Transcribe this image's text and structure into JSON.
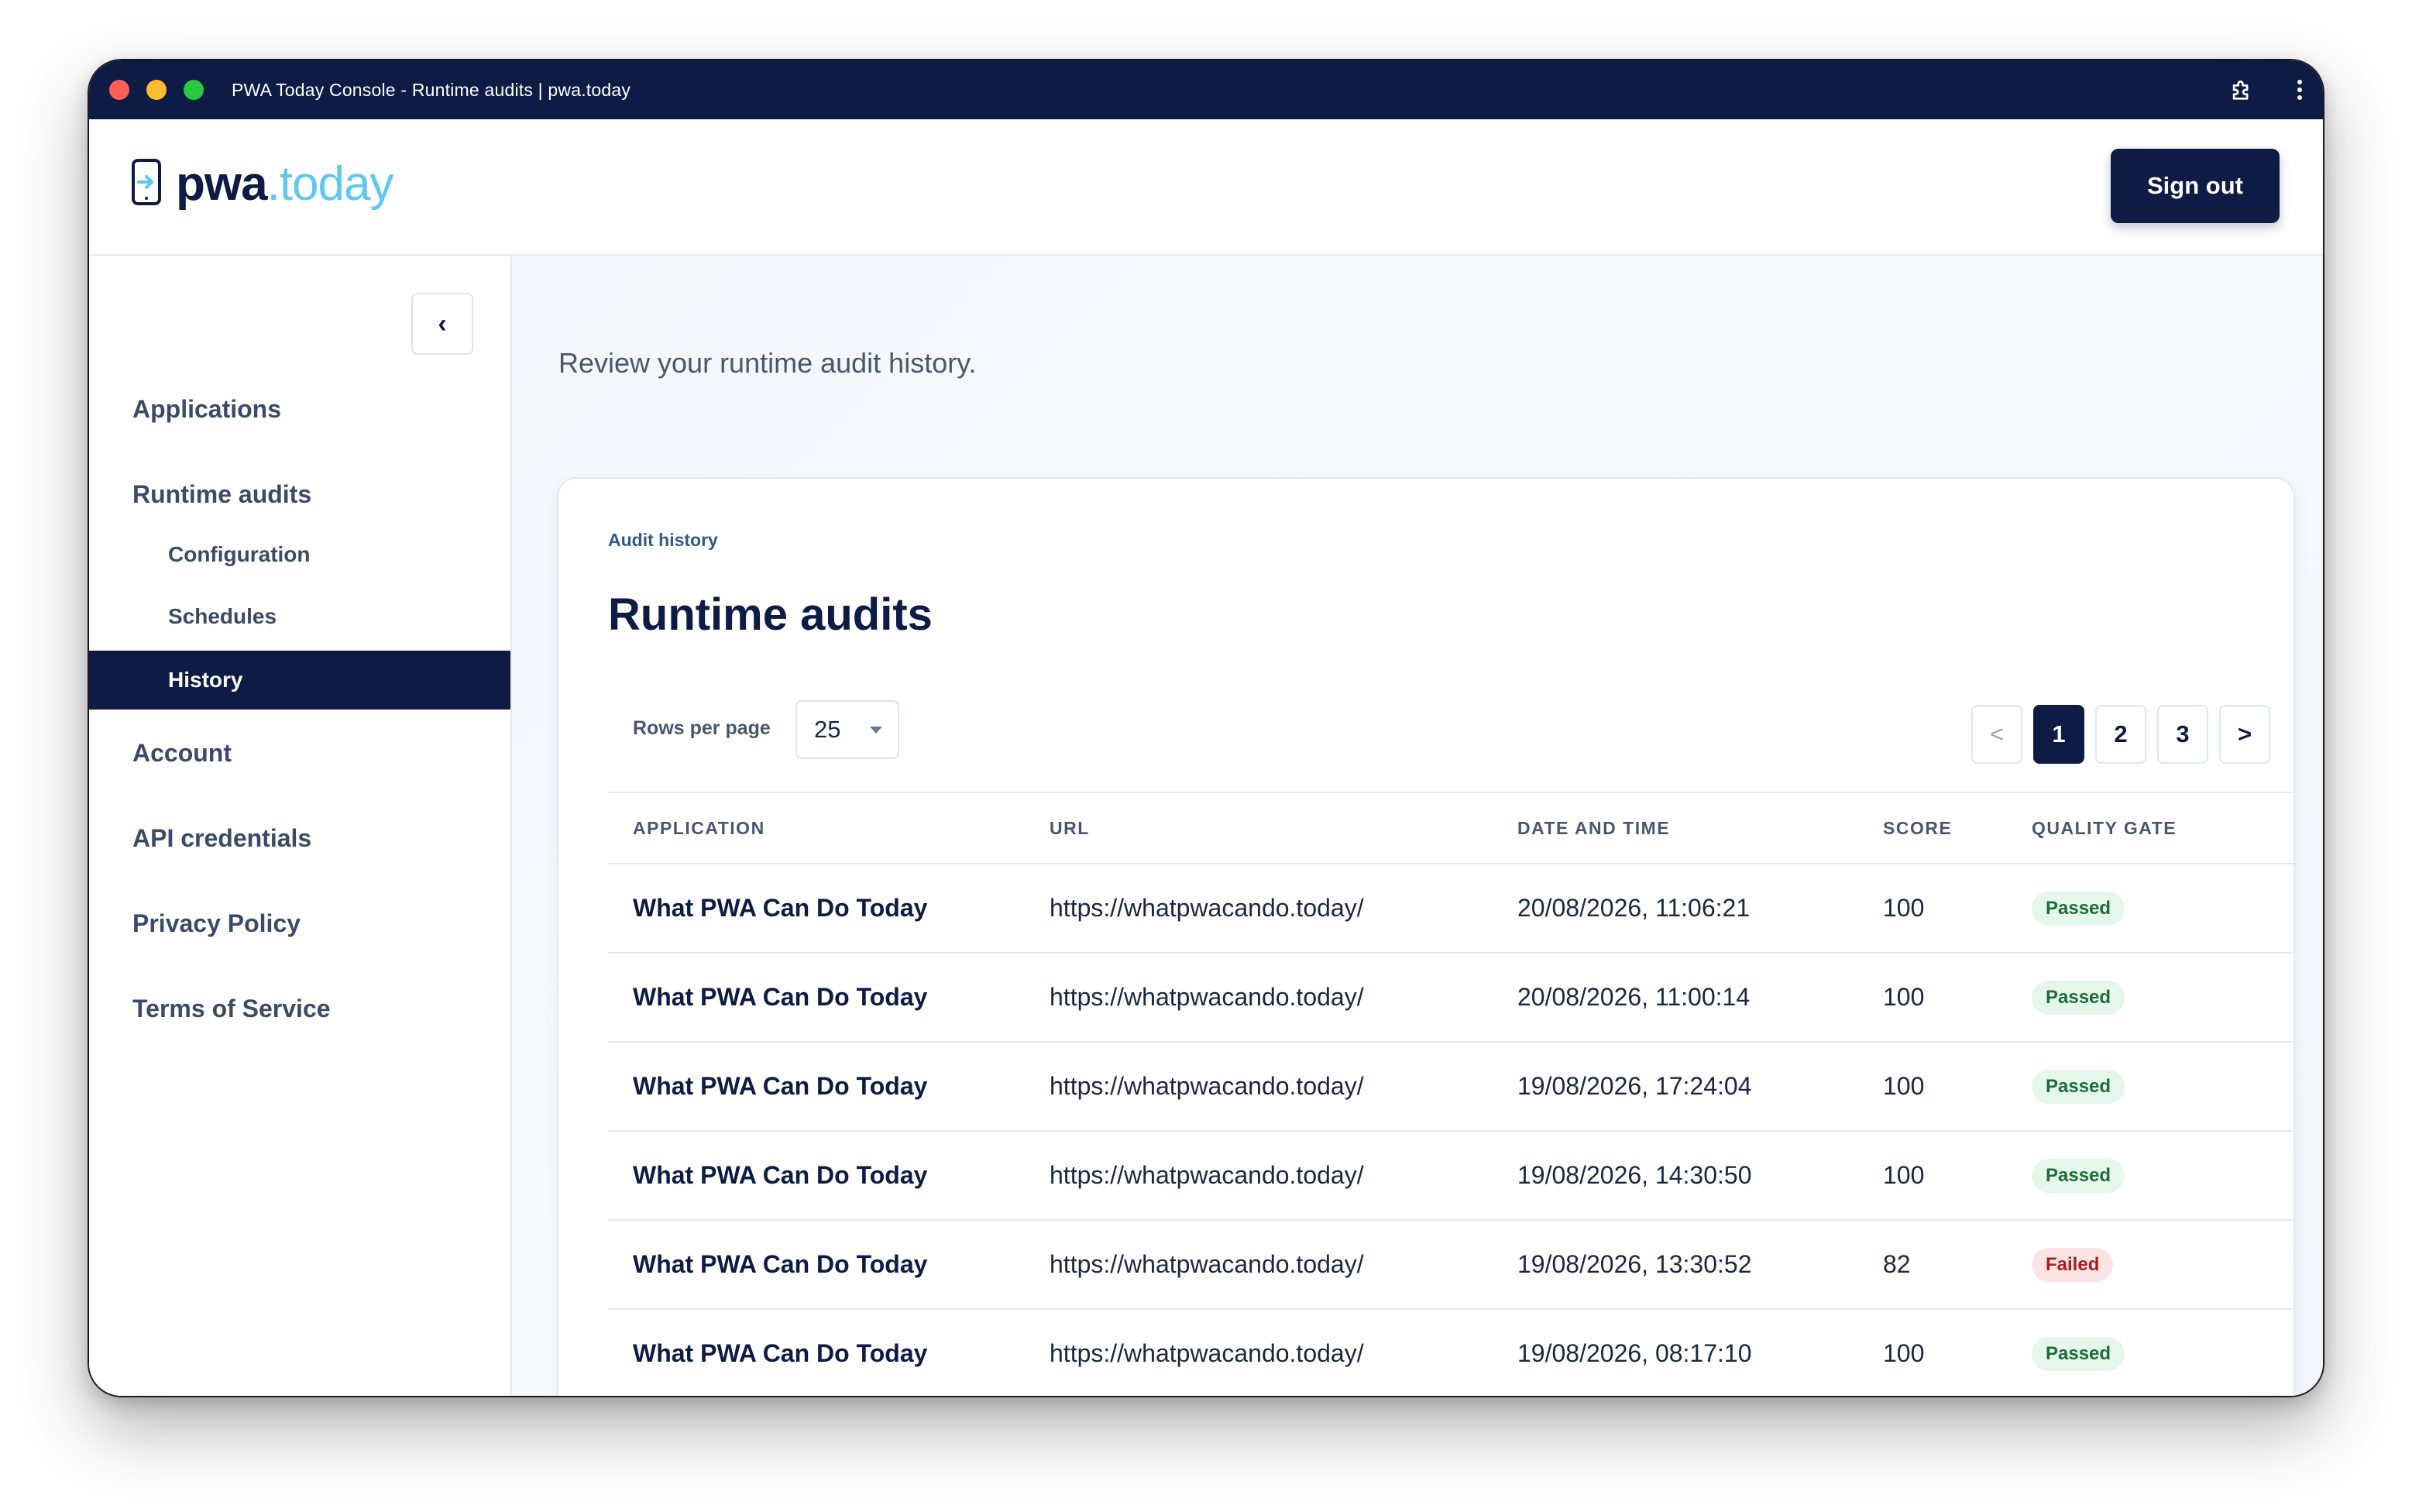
{
  "window": {
    "title": "PWA Today Console - Runtime audits | pwa.today"
  },
  "header": {
    "logo_main": "pwa",
    "logo_accent": ".today",
    "signout_label": "Sign out"
  },
  "sidebar": {
    "collapse_glyph": "‹",
    "items": [
      {
        "label": "Applications"
      },
      {
        "label": "Runtime audits"
      },
      {
        "label": "Configuration"
      },
      {
        "label": "Schedules"
      },
      {
        "label": "History"
      },
      {
        "label": "Account"
      },
      {
        "label": "API credentials"
      },
      {
        "label": "Privacy Policy"
      },
      {
        "label": "Terms of Service"
      }
    ]
  },
  "main": {
    "subtitle": "Review your runtime audit history.",
    "eyebrow": "Audit history",
    "title": "Runtime audits",
    "rows_label": "Rows per page",
    "rows_value": "25",
    "pager": [
      "<",
      "1",
      "2",
      "3",
      ">"
    ],
    "columns": [
      "APPLICATION",
      "URL",
      "DATE AND TIME",
      "SCORE",
      "QUALITY GATE"
    ],
    "rows": [
      {
        "app": "What PWA Can Do Today",
        "url": "https://whatpwacando.today/",
        "datetime": "20/08/2026, 11:06:21",
        "score": "100",
        "gate": "Passed"
      },
      {
        "app": "What PWA Can Do Today",
        "url": "https://whatpwacando.today/",
        "datetime": "20/08/2026, 11:00:14",
        "score": "100",
        "gate": "Passed"
      },
      {
        "app": "What PWA Can Do Today",
        "url": "https://whatpwacando.today/",
        "datetime": "19/08/2026, 17:24:04",
        "score": "100",
        "gate": "Passed"
      },
      {
        "app": "What PWA Can Do Today",
        "url": "https://whatpwacando.today/",
        "datetime": "19/08/2026, 14:30:50",
        "score": "100",
        "gate": "Passed"
      },
      {
        "app": "What PWA Can Do Today",
        "url": "https://whatpwacando.today/",
        "datetime": "19/08/2026, 13:30:52",
        "score": "82",
        "gate": "Failed"
      },
      {
        "app": "What PWA Can Do Today",
        "url": "https://whatpwacando.today/",
        "datetime": "19/08/2026, 08:17:10",
        "score": "100",
        "gate": "Passed"
      }
    ]
  },
  "colors": {
    "navy": "#0e1b45",
    "accent": "#5ec8f0",
    "passed_bg": "#e5f6ea",
    "failed_bg": "#fde4e4"
  },
  "icons": [
    "extension-icon",
    "more-vert-icon",
    "phone-arrow-logo-icon"
  ]
}
